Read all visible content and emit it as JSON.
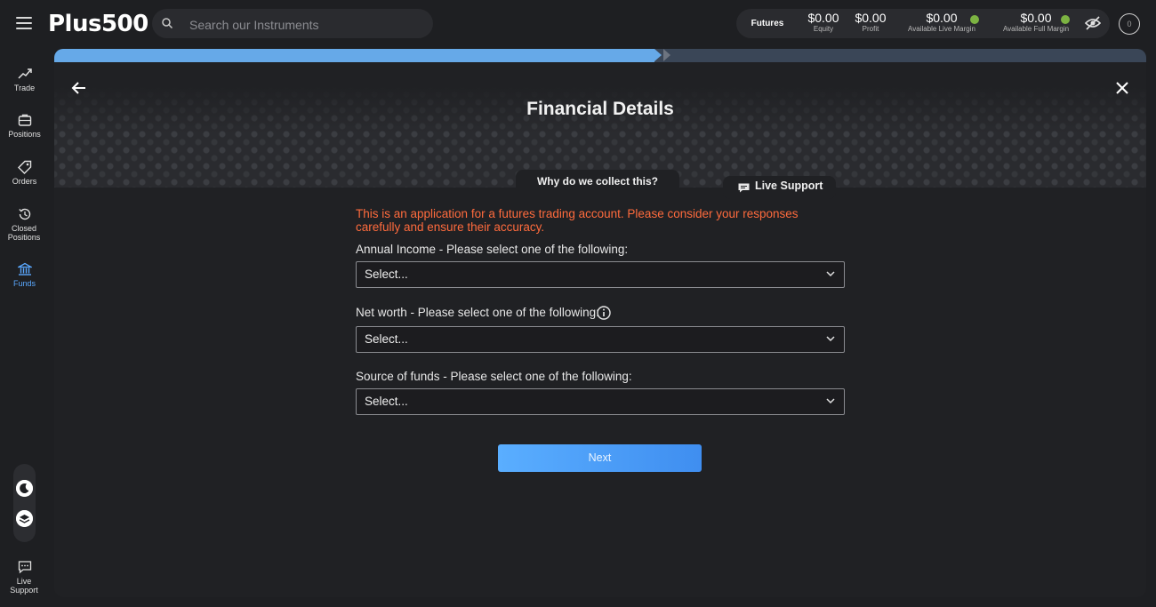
{
  "header": {
    "logo": "Plus500",
    "search_placeholder": "Search our Instruments",
    "futures_label": "Futures",
    "equity": {
      "value": "$0.00",
      "label": "Equity"
    },
    "profit": {
      "value": "$0.00",
      "label": "Profit"
    },
    "live_margin": {
      "value": "$0.00",
      "label": "Available Live Margin"
    },
    "full_margin": {
      "value": "$0.00",
      "label": "Available Full Margin"
    },
    "avatar_initial": "0"
  },
  "sidebar": {
    "items": [
      {
        "label": "Trade",
        "icon": "trend-icon"
      },
      {
        "label": "Positions",
        "icon": "briefcase-icon"
      },
      {
        "label": "Orders",
        "icon": "tag-icon"
      },
      {
        "label": "Closed Positions",
        "icon": "history-icon"
      },
      {
        "label": "Funds",
        "icon": "bank-icon"
      }
    ],
    "live_support": "Live Support"
  },
  "form": {
    "progress": 0.55,
    "title": "Financial Details",
    "why_label": "Why do we collect this?",
    "support_label": "Live Support",
    "notice": "This is an application for a futures trading account. Please consider your responses carefully and ensure their accuracy.",
    "questions": [
      {
        "label": "Annual Income - Please select one of the following:",
        "value": "Select..."
      },
      {
        "label": "Net worth - Please select one of the following:",
        "value": "Select..."
      },
      {
        "label": "Source of funds - Please select one of the following:",
        "value": "Select..."
      }
    ],
    "next_label": "Next"
  },
  "colors": {
    "accent": "#5aa8ff",
    "notice": "#ff6b3d",
    "ok": "#7cb342"
  }
}
